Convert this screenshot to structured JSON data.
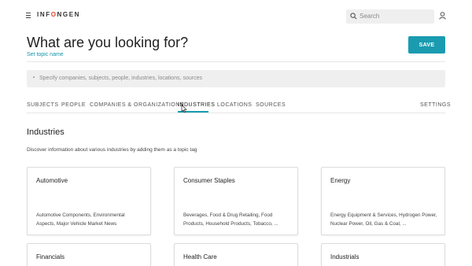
{
  "app": {
    "logo": "INFONGEN"
  },
  "search": {
    "placeholder": "Search"
  },
  "header": {
    "title": "What are you looking for?",
    "set_topic_link": "Set topic name",
    "save_label": "SAVE"
  },
  "entity_input": {
    "placeholder": "Specify companies, subjects, people, industries, locations, sources"
  },
  "tabs": [
    {
      "label": "SUBJECTS"
    },
    {
      "label": "PEOPLE"
    },
    {
      "label": "COMPANIES & ORGANIZATIONS"
    },
    {
      "label": "INDUSTRIES"
    },
    {
      "label": "LOCATIONS"
    },
    {
      "label": "SOURCES"
    }
  ],
  "settings_label": "SETTINGS",
  "active_tab": "INDUSTRIES",
  "section": {
    "title": "Industries",
    "description": "Discover information about various industries by adding them as a topic tag"
  },
  "cards": [
    {
      "title": "Automotive",
      "desc": "Automotive Components, Environmental Aspects, Major Vehicle Market News"
    },
    {
      "title": "Consumer Staples",
      "desc": "Beverages, Food & Drug Retailing, Food Products, Household Products, Tobacco, ..."
    },
    {
      "title": "Energy",
      "desc": "Energy Equipment & Services, Hydrogen Power, Nuclear Power, Oil, Gas & Coal, ..."
    },
    {
      "title": "Financials",
      "desc": ""
    },
    {
      "title": "Health Care",
      "desc": ""
    },
    {
      "title": "Industrials",
      "desc": ""
    }
  ],
  "colors": {
    "accent": "#1a9bb0",
    "logo_o": "#e9472f"
  }
}
